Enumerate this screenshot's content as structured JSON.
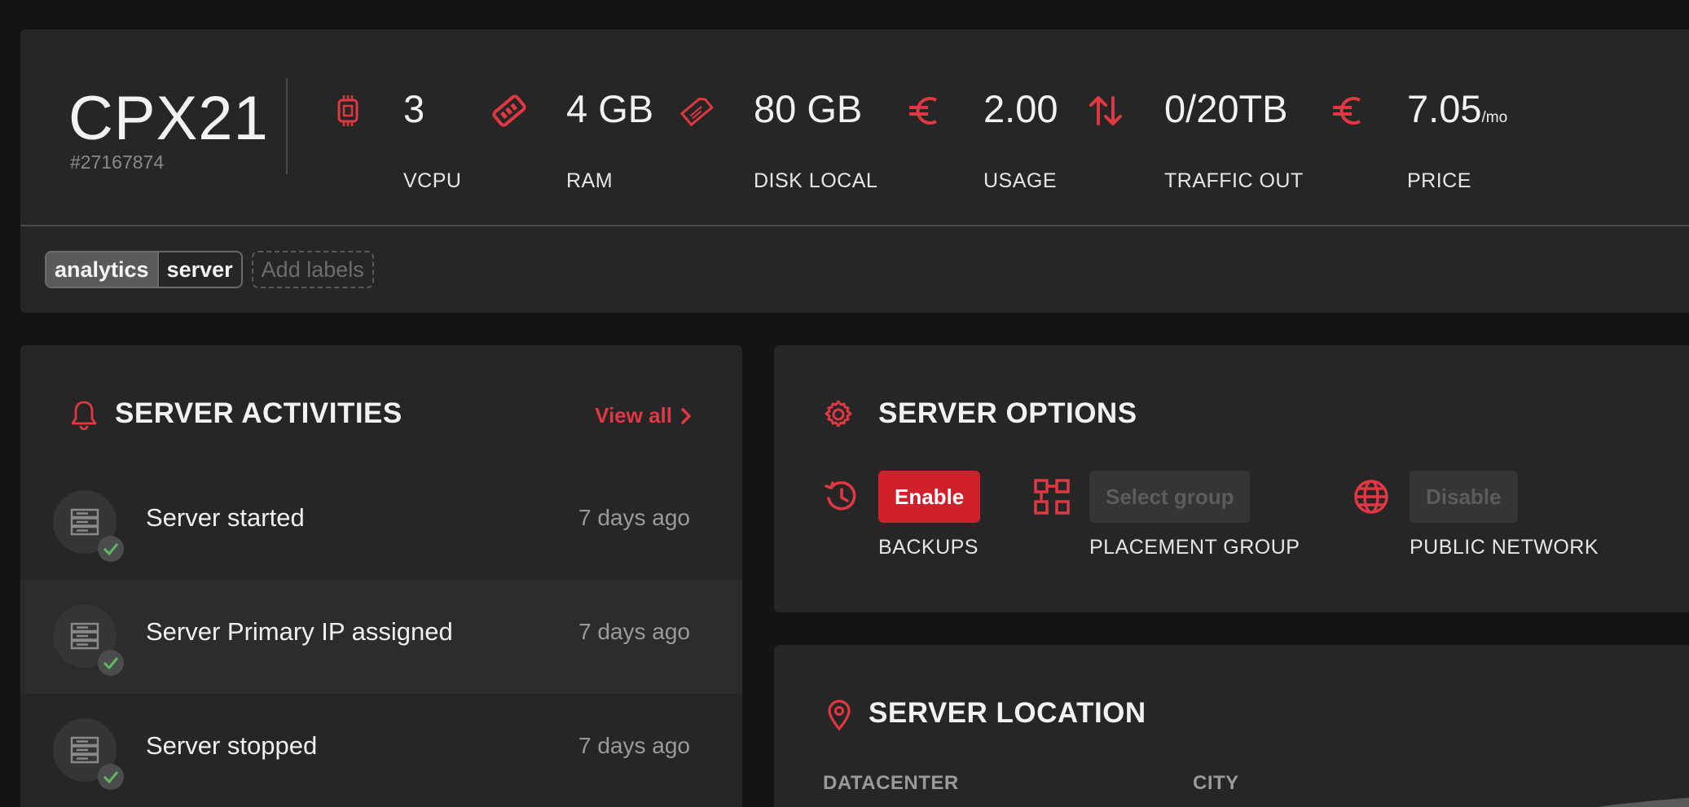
{
  "server": {
    "name": "CPX21",
    "id": "#27167874"
  },
  "stats": [
    {
      "icon": "cpu-icon",
      "value": "3",
      "unit": "",
      "label": "VCPU"
    },
    {
      "icon": "ram-icon",
      "value": "4 GB",
      "unit": "",
      "label": "RAM"
    },
    {
      "icon": "disk-icon",
      "value": "80 GB",
      "unit": "",
      "label": "DISK LOCAL"
    },
    {
      "icon": "euro-icon",
      "value": "2.00",
      "unit": "",
      "label": "USAGE"
    },
    {
      "icon": "traffic-icon",
      "value": "0/20TB",
      "unit": "",
      "label": "TRAFFIC OUT"
    },
    {
      "icon": "euro-icon",
      "value": "7.05",
      "unit": "/mo",
      "label": "PRICE"
    }
  ],
  "labels": {
    "items": [
      {
        "key": "analytics",
        "value": "server"
      }
    ],
    "add_placeholder": "Add labels"
  },
  "activities": {
    "title": "SERVER ACTIVITIES",
    "view_all": "View all",
    "items": [
      {
        "text": "Server started",
        "time": "7 days ago"
      },
      {
        "text": "Server Primary IP assigned",
        "time": "7 days ago"
      },
      {
        "text": "Server stopped",
        "time": "7 days ago"
      }
    ]
  },
  "options": {
    "title": "SERVER OPTIONS",
    "items": [
      {
        "icon": "backup-icon",
        "button": "Enable",
        "label": "BACKUPS",
        "state": "primary"
      },
      {
        "icon": "placement-group-icon",
        "button": "Select group",
        "label": "PLACEMENT GROUP",
        "state": "disabled"
      },
      {
        "icon": "globe-icon",
        "button": "Disable",
        "label": "PUBLIC NETWORK",
        "state": "disabled"
      }
    ]
  },
  "location": {
    "title": "SERVER LOCATION",
    "col_datacenter": "DATACENTER",
    "col_city": "CITY"
  },
  "colors": {
    "accent": "#e03842",
    "background": "#141414",
    "card": "#262626",
    "success": "#5fb85f"
  }
}
